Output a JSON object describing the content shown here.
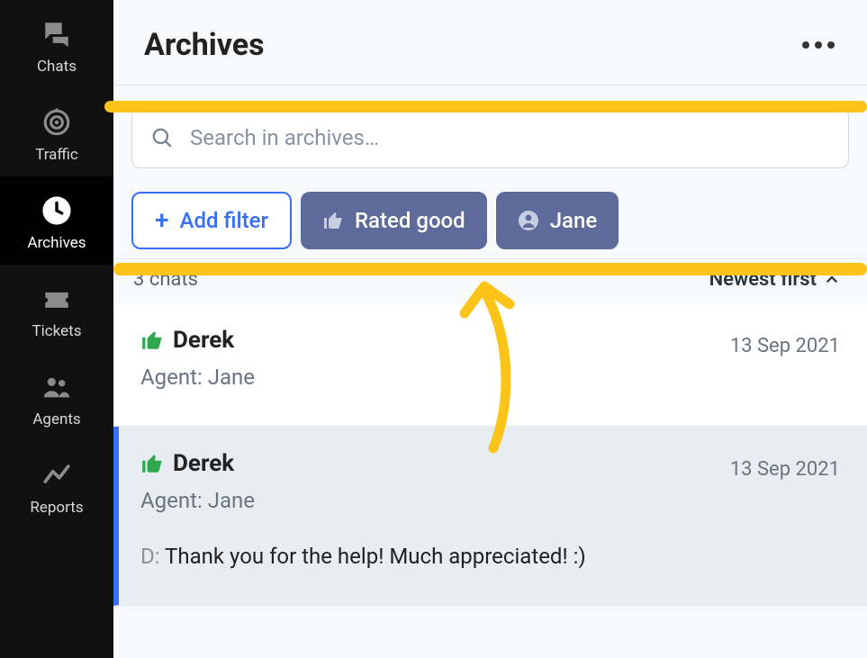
{
  "sidebar": {
    "items": [
      {
        "label": "Chats"
      },
      {
        "label": "Traffic"
      },
      {
        "label": "Archives"
      },
      {
        "label": "Tickets"
      },
      {
        "label": "Agents"
      },
      {
        "label": "Reports"
      }
    ]
  },
  "header": {
    "title": "Archives"
  },
  "search": {
    "placeholder": "Search in archives…"
  },
  "filters": {
    "add_label": "Add filter",
    "active": [
      {
        "icon": "thumbs-up-icon",
        "label": "Rated good"
      },
      {
        "icon": "person-icon",
        "label": "Jane"
      }
    ]
  },
  "meta": {
    "count_text": "3 chats",
    "sort_label": "Newest first"
  },
  "chats": [
    {
      "name": "Derek",
      "agent_line": "Agent: Jane",
      "date": "13 Sep 2021",
      "rated_good": true,
      "selected": false
    },
    {
      "name": "Derek",
      "agent_line": "Agent: Jane",
      "date": "13 Sep 2021",
      "rated_good": true,
      "selected": true,
      "message_prefix": "D:",
      "message": "Thank you for the help! Much appreciated! :)"
    }
  ],
  "colors": {
    "accent": "#3670f5",
    "good": "#2fa84f",
    "chip": "#5e6a9a",
    "highlight": "#fcc419"
  }
}
